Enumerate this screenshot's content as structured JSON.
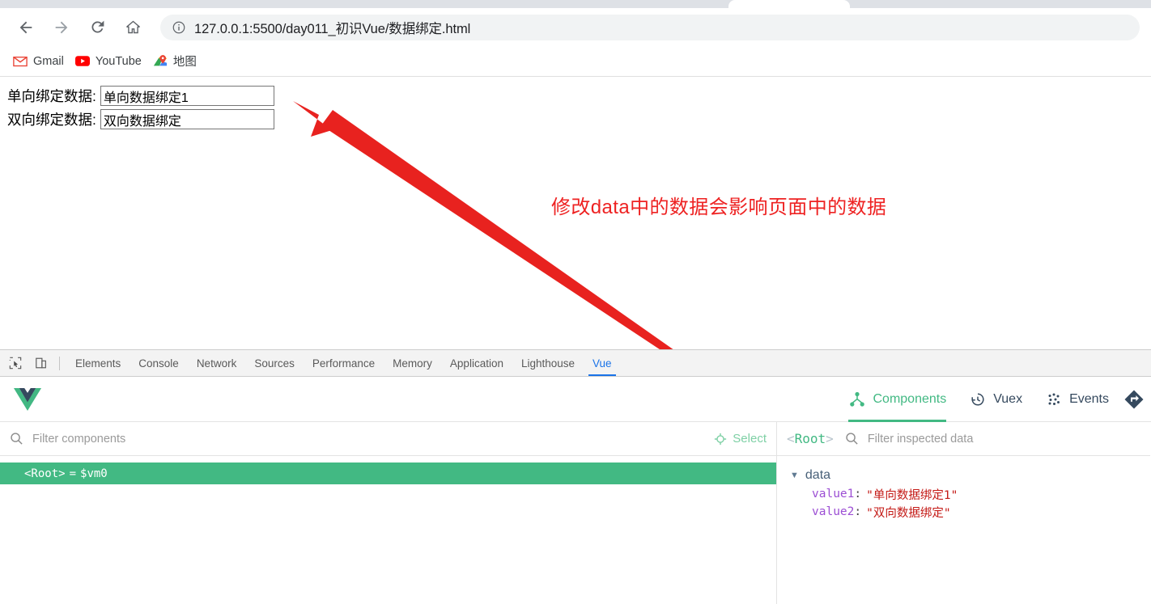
{
  "browser": {
    "nav": {
      "back_icon": "arrow-left-icon",
      "forward_icon": "arrow-right-icon",
      "reload_icon": "reload-icon",
      "home_icon": "home-icon"
    },
    "omnibox": {
      "info_icon": "info-circle-icon",
      "url": "127.0.0.1:5500/day011_初识Vue/数据绑定.html"
    },
    "bookmarks": [
      {
        "icon": "gmail-icon",
        "label": "Gmail"
      },
      {
        "icon": "youtube-icon",
        "label": "YouTube"
      },
      {
        "icon": "google-maps-icon",
        "label": "地图"
      }
    ]
  },
  "page": {
    "rows": [
      {
        "label": "单向绑定数据:",
        "value": "单向数据绑定1"
      },
      {
        "label": "双向绑定数据:",
        "value": "双向数据绑定"
      }
    ],
    "annotation": {
      "text": "修改data中的数据会影响页面中的数据",
      "color": "#ee2222",
      "arrow_icon": "red-arrow-annotation"
    }
  },
  "devtools": {
    "left_icons": [
      {
        "name": "inspect-element-icon"
      },
      {
        "name": "device-toolbar-icon"
      }
    ],
    "tabs": [
      {
        "label": "Elements",
        "active": false
      },
      {
        "label": "Console",
        "active": false
      },
      {
        "label": "Network",
        "active": false
      },
      {
        "label": "Sources",
        "active": false
      },
      {
        "label": "Performance",
        "active": false
      },
      {
        "label": "Memory",
        "active": false
      },
      {
        "label": "Application",
        "active": false
      },
      {
        "label": "Lighthouse",
        "active": false
      },
      {
        "label": "Vue",
        "active": true
      }
    ],
    "active_tab_color": "#1a73e8"
  },
  "vue_devtools": {
    "logo_icon": "vue-logo-icon",
    "accent_color": "#42b983",
    "tabs": [
      {
        "label": "Components",
        "icon": "component-tree-icon",
        "active": true
      },
      {
        "label": "Vuex",
        "icon": "history-clock-icon",
        "active": false
      },
      {
        "label": "Events",
        "icon": "events-dots-icon",
        "active": false
      }
    ],
    "router_icon": "router-arrow-icon",
    "components_panel": {
      "search_icon": "search-icon",
      "filter_placeholder": "Filter components",
      "filter_value": "",
      "select_button": {
        "label": "Select",
        "icon": "crosshair-icon"
      },
      "tree": [
        {
          "tag": "<Root>",
          "eq": "=",
          "instance": "$vm0",
          "selected": true
        }
      ]
    },
    "inspector_panel": {
      "root_label": "<Root>",
      "search_icon": "search-icon",
      "filter_placeholder": "Filter inspected data",
      "filter_value": "",
      "groups": [
        {
          "name": "data",
          "expanded": true,
          "triangle": "▼",
          "entries": [
            {
              "key": "value1",
              "value": "\"单向数据绑定1\""
            },
            {
              "key": "value2",
              "value": "\"双向数据绑定\""
            }
          ]
        }
      ]
    }
  }
}
